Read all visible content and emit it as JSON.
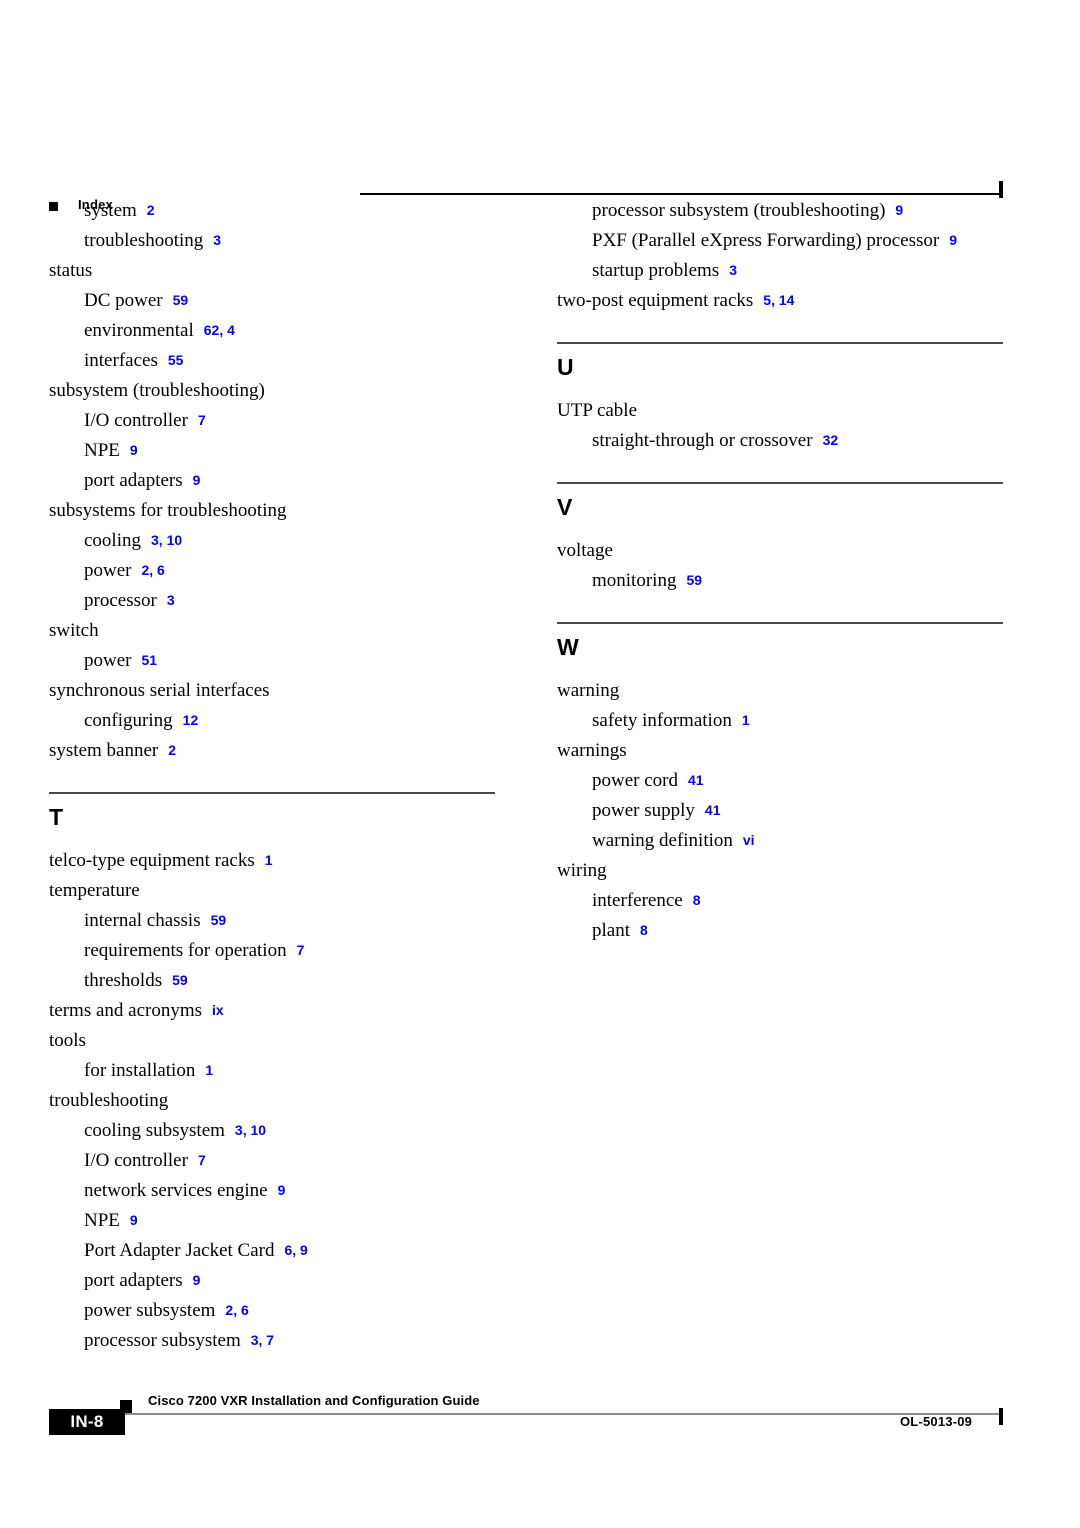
{
  "header": {
    "title": "Index"
  },
  "columns": {
    "left": [
      {
        "kind": "entry",
        "level": 2,
        "term": "system",
        "pages": "2"
      },
      {
        "kind": "entry",
        "level": 2,
        "term": "troubleshooting",
        "pages": "3"
      },
      {
        "kind": "entry",
        "level": 1,
        "term": "status",
        "pages": ""
      },
      {
        "kind": "entry",
        "level": 2,
        "term": "DC power",
        "pages": "59"
      },
      {
        "kind": "entry",
        "level": 2,
        "term": "environmental",
        "pages": "62, 4"
      },
      {
        "kind": "entry",
        "level": 2,
        "term": "interfaces",
        "pages": "55"
      },
      {
        "kind": "entry",
        "level": 1,
        "term": "subsystem (troubleshooting)",
        "pages": ""
      },
      {
        "kind": "entry",
        "level": 2,
        "term": "I/O controller",
        "pages": "7"
      },
      {
        "kind": "entry",
        "level": 2,
        "term": "NPE",
        "pages": "9"
      },
      {
        "kind": "entry",
        "level": 2,
        "term": "port adapters",
        "pages": "9"
      },
      {
        "kind": "entry",
        "level": 1,
        "term": "subsystems for troubleshooting",
        "pages": ""
      },
      {
        "kind": "entry",
        "level": 2,
        "term": "cooling",
        "pages": "3, 10"
      },
      {
        "kind": "entry",
        "level": 2,
        "term": "power",
        "pages": "2, 6"
      },
      {
        "kind": "entry",
        "level": 2,
        "term": "processor",
        "pages": "3"
      },
      {
        "kind": "entry",
        "level": 1,
        "term": "switch",
        "pages": ""
      },
      {
        "kind": "entry",
        "level": 2,
        "term": "power",
        "pages": "51"
      },
      {
        "kind": "entry",
        "level": 1,
        "term": "synchronous serial interfaces",
        "pages": ""
      },
      {
        "kind": "entry",
        "level": 2,
        "term": "configuring",
        "pages": "12"
      },
      {
        "kind": "entry",
        "level": 1,
        "term": "system banner",
        "pages": "2"
      },
      {
        "kind": "section",
        "letter": "T"
      },
      {
        "kind": "entry",
        "level": 1,
        "term": "telco-type equipment racks",
        "pages": "1"
      },
      {
        "kind": "entry",
        "level": 1,
        "term": "temperature",
        "pages": ""
      },
      {
        "kind": "entry",
        "level": 2,
        "term": "internal chassis",
        "pages": "59"
      },
      {
        "kind": "entry",
        "level": 2,
        "term": "requirements for operation",
        "pages": "7"
      },
      {
        "kind": "entry",
        "level": 2,
        "term": "thresholds",
        "pages": "59"
      },
      {
        "kind": "entry",
        "level": 1,
        "term": "terms and acronyms",
        "pages": "ix"
      },
      {
        "kind": "entry",
        "level": 1,
        "term": "tools",
        "pages": ""
      },
      {
        "kind": "entry",
        "level": 2,
        "term": "for installation",
        "pages": "1"
      },
      {
        "kind": "entry",
        "level": 1,
        "term": "troubleshooting",
        "pages": ""
      },
      {
        "kind": "entry",
        "level": 2,
        "term": "cooling subsystem",
        "pages": "3, 10"
      },
      {
        "kind": "entry",
        "level": 2,
        "term": "I/O controller",
        "pages": "7"
      },
      {
        "kind": "entry",
        "level": 2,
        "term": "network services engine",
        "pages": "9"
      },
      {
        "kind": "entry",
        "level": 2,
        "term": "NPE",
        "pages": "9"
      },
      {
        "kind": "entry",
        "level": 2,
        "term": "Port Adapter Jacket Card",
        "pages": "6, 9"
      },
      {
        "kind": "entry",
        "level": 2,
        "term": "port adapters",
        "pages": "9"
      },
      {
        "kind": "entry",
        "level": 2,
        "term": "power subsystem",
        "pages": "2, 6"
      },
      {
        "kind": "entry",
        "level": 2,
        "term": "processor subsystem",
        "pages": "3, 7"
      }
    ],
    "right": [
      {
        "kind": "entry",
        "level": 2,
        "term": "processor subsystem (troubleshooting)",
        "pages": "9"
      },
      {
        "kind": "entry",
        "level": 2,
        "term": "PXF (Parallel eXpress Forwarding) processor",
        "pages": "9"
      },
      {
        "kind": "entry",
        "level": 2,
        "term": "startup problems",
        "pages": "3"
      },
      {
        "kind": "entry",
        "level": 1,
        "term": "two-post equipment racks",
        "pages": "5, 14"
      },
      {
        "kind": "section",
        "letter": "U"
      },
      {
        "kind": "entry",
        "level": 1,
        "term": "UTP cable",
        "pages": ""
      },
      {
        "kind": "entry",
        "level": 2,
        "term": "straight-through or crossover",
        "pages": "32"
      },
      {
        "kind": "section",
        "letter": "V"
      },
      {
        "kind": "entry",
        "level": 1,
        "term": "voltage",
        "pages": ""
      },
      {
        "kind": "entry",
        "level": 2,
        "term": "monitoring",
        "pages": "59"
      },
      {
        "kind": "section",
        "letter": "W"
      },
      {
        "kind": "entry",
        "level": 1,
        "term": "warning",
        "pages": ""
      },
      {
        "kind": "entry",
        "level": 2,
        "term": "safety information",
        "pages": "1"
      },
      {
        "kind": "entry",
        "level": 1,
        "term": "warnings",
        "pages": ""
      },
      {
        "kind": "entry",
        "level": 2,
        "term": "power cord",
        "pages": "41"
      },
      {
        "kind": "entry",
        "level": 2,
        "term": "power supply",
        "pages": "41"
      },
      {
        "kind": "entry",
        "level": 2,
        "term": "warning definition",
        "pages": "vi"
      },
      {
        "kind": "entry",
        "level": 1,
        "term": "wiring",
        "pages": ""
      },
      {
        "kind": "entry",
        "level": 2,
        "term": "interference",
        "pages": "8"
      },
      {
        "kind": "entry",
        "level": 2,
        "term": "plant",
        "pages": "8"
      }
    ]
  },
  "footer": {
    "page_label": "IN-8",
    "guide_title": "Cisco 7200 VXR Installation and Configuration Guide",
    "doc_id": "OL-5013-09"
  },
  "colors": {
    "page_number": "#0000ff",
    "rule": "#4a4a4a",
    "text": "#000000"
  }
}
